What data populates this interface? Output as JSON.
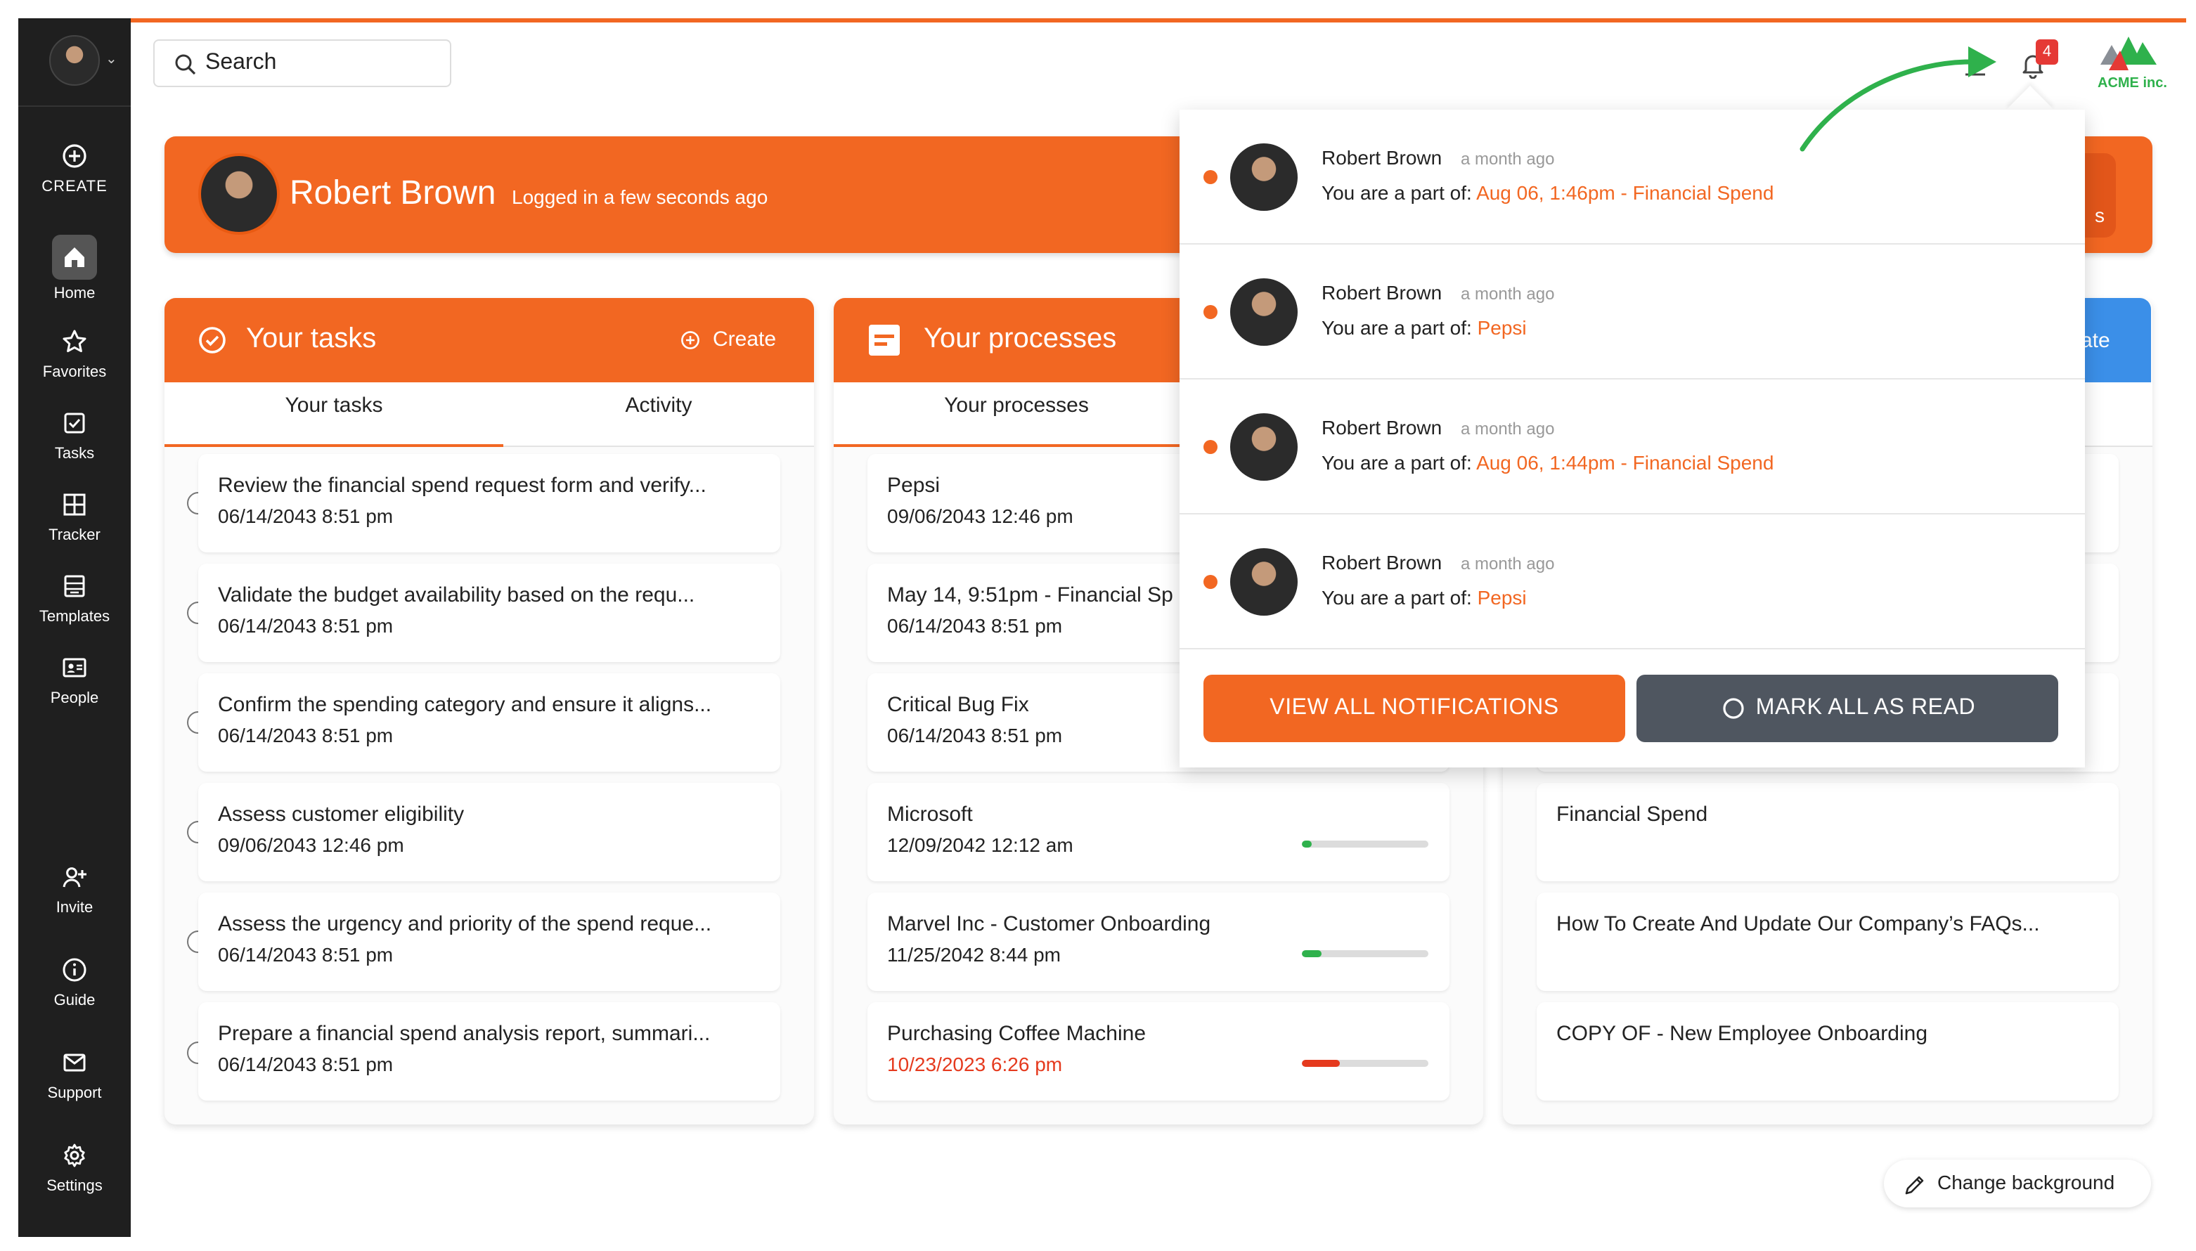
{
  "search": {
    "placeholder": "Search"
  },
  "sidebar": {
    "items": [
      {
        "label": "CREATE",
        "icon": "plus-circle-icon"
      },
      {
        "label": "Home",
        "icon": "home-icon"
      },
      {
        "label": "Favorites",
        "icon": "star-icon"
      },
      {
        "label": "Tasks",
        "icon": "checkbox-icon"
      },
      {
        "label": "Tracker",
        "icon": "grid-icon"
      },
      {
        "label": "Templates",
        "icon": "template-icon"
      },
      {
        "label": "People",
        "icon": "id-card-icon"
      },
      {
        "label": "Invite",
        "icon": "add-user-icon"
      },
      {
        "label": "Guide",
        "icon": "info-icon"
      },
      {
        "label": "Support",
        "icon": "mail-icon"
      },
      {
        "label": "Settings",
        "icon": "gear-icon"
      }
    ]
  },
  "banner": {
    "name": "Robert Brown",
    "status": "Logged in a few seconds ago",
    "button_partial": "s"
  },
  "tasks_panel": {
    "title": "Your tasks",
    "create_label": "Create",
    "tabs": [
      "Your tasks",
      "Activity"
    ],
    "items": [
      {
        "title": "Review the financial spend request form and verify...",
        "date": "06/14/2043 8:51 pm"
      },
      {
        "title": "Validate the budget availability based on the requ...",
        "date": "06/14/2043 8:51 pm"
      },
      {
        "title": "Confirm the spending category and ensure it aligns...",
        "date": "06/14/2043 8:51 pm"
      },
      {
        "title": "Assess customer eligibility",
        "date": "09/06/2043 12:46 pm"
      },
      {
        "title": "Assess the urgency and priority of the spend reque...",
        "date": "06/14/2043 8:51 pm"
      },
      {
        "title": "Prepare a financial spend analysis report, summari...",
        "date": "06/14/2043 8:51 pm"
      }
    ]
  },
  "processes_panel": {
    "title": "Your processes",
    "tabs": [
      "Your processes"
    ],
    "items": [
      {
        "title": "Pepsi",
        "date": "09/06/2043 12:46 pm"
      },
      {
        "title": "May 14, 9:51pm - Financial Sp",
        "date": "06/14/2043 8:51 pm"
      },
      {
        "title": "Critical Bug Fix",
        "date": "06/14/2043 8:51 pm"
      },
      {
        "title": "Microsoft",
        "date": "12/09/2042 12:12 am",
        "progress": 0.08,
        "color": "#2fb14c"
      },
      {
        "title": "Marvel Inc - Customer Onboarding",
        "date": "11/25/2042 8:44 pm",
        "progress": 0.16,
        "color": "#2fb14c"
      },
      {
        "title": "Purchasing Coffee Machine",
        "date": "10/23/2023 6:26 pm",
        "progress": 0.3,
        "color": "#e53a1e",
        "overdue": true
      }
    ]
  },
  "templates_panel": {
    "create_partial": "ate",
    "items": [
      {
        "title": "Financial Spend"
      },
      {
        "title": "How To Create And Update Our Company’s FAQs..."
      },
      {
        "title": "COPY OF - New Employee Onboarding"
      }
    ]
  },
  "header": {
    "notification_count": "4",
    "logo_text": "ACME inc."
  },
  "notifications": {
    "items": [
      {
        "name": "Robert Brown",
        "time": "a month ago",
        "prefix": "You are a part of:",
        "link": "Aug 06, 1:46pm - Financial Spend"
      },
      {
        "name": "Robert Brown",
        "time": "a month ago",
        "prefix": "You are a part of:",
        "link": "Pepsi"
      },
      {
        "name": "Robert Brown",
        "time": "a month ago",
        "prefix": "You are a part of:",
        "link": "Aug 06, 1:44pm - Financial Spend"
      },
      {
        "name": "Robert Brown",
        "time": "a month ago",
        "prefix": "You are a part of:",
        "link": "Pepsi"
      }
    ],
    "view_all_label": "VIEW ALL NOTIFICATIONS",
    "mark_read_label": "MARK ALL AS READ"
  },
  "change_background_label": "Change background",
  "colors": {
    "accent": "#f26722",
    "sidebar": "#1f1f1f",
    "blue": "#3b8fe8",
    "dark_button": "#4f5660"
  }
}
